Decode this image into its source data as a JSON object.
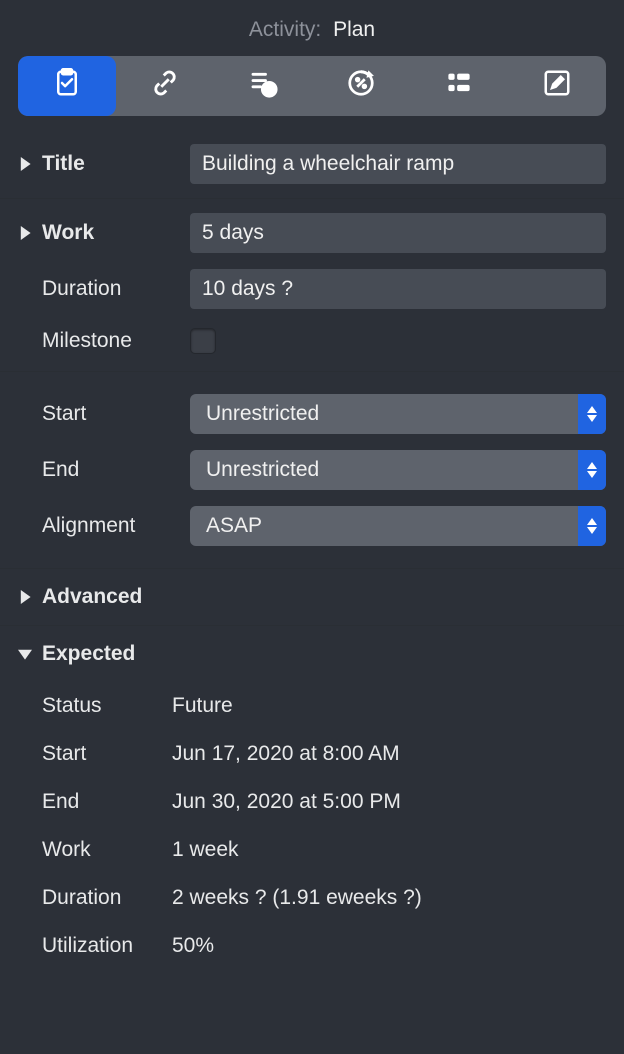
{
  "header": {
    "label": "Activity:",
    "value": "Plan"
  },
  "tabs": [
    {
      "id": "clipboard-icon"
    },
    {
      "id": "link-icon"
    },
    {
      "id": "cost-icon"
    },
    {
      "id": "percent-icon"
    },
    {
      "id": "list-icon"
    },
    {
      "id": "edit-icon"
    }
  ],
  "fields": {
    "title_label": "Title",
    "title_value": "Building a wheelchair ramp",
    "work_label": "Work",
    "work_value": "5 days",
    "duration_label": "Duration",
    "duration_value": "10 days ?",
    "milestone_label": "Milestone",
    "start_label": "Start",
    "start_value": "Unrestricted",
    "end_label": "End",
    "end_value": "Unrestricted",
    "alignment_label": "Alignment",
    "alignment_value": "ASAP"
  },
  "sections": {
    "advanced_label": "Advanced",
    "expected_label": "Expected"
  },
  "expected": {
    "status_label": "Status",
    "status_value": "Future",
    "start_label": "Start",
    "start_value": "Jun 17, 2020 at 8:00 AM",
    "end_label": "End",
    "end_value": "Jun 30, 2020 at 5:00 PM",
    "work_label": "Work",
    "work_value": "1 week",
    "duration_label": "Duration",
    "duration_value": "2 weeks ? (1.91 eweeks ?)",
    "utilization_label": "Utilization",
    "utilization_value": "50%"
  }
}
